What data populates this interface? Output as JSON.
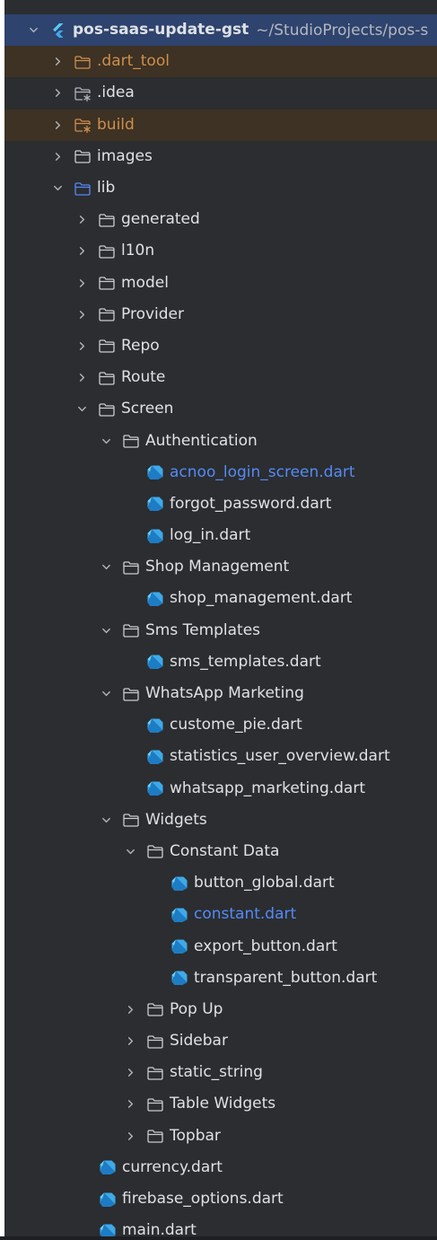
{
  "colors": {
    "background": "#2b2d30",
    "selected_row": "#2e436e",
    "excluded_row": "#3d3223",
    "text": "#dfe1e5",
    "modified_blue": "#548af7",
    "excluded_orange": "#d08d4f",
    "dart_icon": "#3fa9e8"
  },
  "tree": {
    "project": {
      "name": "pos-saas-update-gst",
      "path": "~/StudioProjects/pos-s",
      "icon": "flutter-icon"
    },
    "items": [
      {
        "label": ".dart_tool",
        "indent": 1,
        "kind": "folder",
        "state": "collapsed",
        "style": "excluded"
      },
      {
        "label": ".idea",
        "indent": 1,
        "kind": "config-folder",
        "state": "collapsed"
      },
      {
        "label": "build",
        "indent": 1,
        "kind": "config-folder",
        "state": "collapsed",
        "style": "excluded"
      },
      {
        "label": "images",
        "indent": 1,
        "kind": "folder",
        "state": "collapsed"
      },
      {
        "label": "lib",
        "indent": 1,
        "kind": "source-folder",
        "state": "expanded"
      },
      {
        "label": "generated",
        "indent": 2,
        "kind": "folder",
        "state": "collapsed"
      },
      {
        "label": "l10n",
        "indent": 2,
        "kind": "folder",
        "state": "collapsed"
      },
      {
        "label": "model",
        "indent": 2,
        "kind": "folder",
        "state": "collapsed"
      },
      {
        "label": "Provider",
        "indent": 2,
        "kind": "folder",
        "state": "collapsed"
      },
      {
        "label": "Repo",
        "indent": 2,
        "kind": "folder",
        "state": "collapsed"
      },
      {
        "label": "Route",
        "indent": 2,
        "kind": "folder",
        "state": "collapsed"
      },
      {
        "label": "Screen",
        "indent": 2,
        "kind": "folder",
        "state": "expanded"
      },
      {
        "label": "Authentication",
        "indent": 3,
        "kind": "folder",
        "state": "expanded"
      },
      {
        "label": "acnoo_login_screen.dart",
        "indent": 4,
        "kind": "dart",
        "style": "modified"
      },
      {
        "label": "forgot_password.dart",
        "indent": 4,
        "kind": "dart"
      },
      {
        "label": "log_in.dart",
        "indent": 4,
        "kind": "dart"
      },
      {
        "label": "Shop Management",
        "indent": 3,
        "kind": "folder",
        "state": "expanded"
      },
      {
        "label": "shop_management.dart",
        "indent": 4,
        "kind": "dart"
      },
      {
        "label": "Sms Templates",
        "indent": 3,
        "kind": "folder",
        "state": "expanded"
      },
      {
        "label": "sms_templates.dart",
        "indent": 4,
        "kind": "dart"
      },
      {
        "label": "WhatsApp Marketing",
        "indent": 3,
        "kind": "folder",
        "state": "expanded"
      },
      {
        "label": "custome_pie.dart",
        "indent": 4,
        "kind": "dart"
      },
      {
        "label": "statistics_user_overview.dart",
        "indent": 4,
        "kind": "dart"
      },
      {
        "label": "whatsapp_marketing.dart",
        "indent": 4,
        "kind": "dart"
      },
      {
        "label": "Widgets",
        "indent": 3,
        "kind": "folder",
        "state": "expanded"
      },
      {
        "label": "Constant Data",
        "indent": 4,
        "kind": "folder",
        "state": "expanded"
      },
      {
        "label": "button_global.dart",
        "indent": 5,
        "kind": "dart"
      },
      {
        "label": "constant.dart",
        "indent": 5,
        "kind": "dart",
        "style": "modified"
      },
      {
        "label": "export_button.dart",
        "indent": 5,
        "kind": "dart"
      },
      {
        "label": "transparent_button.dart",
        "indent": 5,
        "kind": "dart"
      },
      {
        "label": "Pop Up",
        "indent": 4,
        "kind": "folder",
        "state": "collapsed"
      },
      {
        "label": "Sidebar",
        "indent": 4,
        "kind": "folder",
        "state": "collapsed"
      },
      {
        "label": "static_string",
        "indent": 4,
        "kind": "folder",
        "state": "collapsed"
      },
      {
        "label": "Table Widgets",
        "indent": 4,
        "kind": "folder",
        "state": "collapsed"
      },
      {
        "label": "Topbar",
        "indent": 4,
        "kind": "folder",
        "state": "collapsed"
      },
      {
        "label": "currency.dart",
        "indent": 3,
        "kind": "dart",
        "flush": true
      },
      {
        "label": "firebase_options.dart",
        "indent": 3,
        "kind": "dart",
        "flush": true
      },
      {
        "label": "main.dart",
        "indent": 3,
        "kind": "dart",
        "flush": true
      }
    ]
  }
}
